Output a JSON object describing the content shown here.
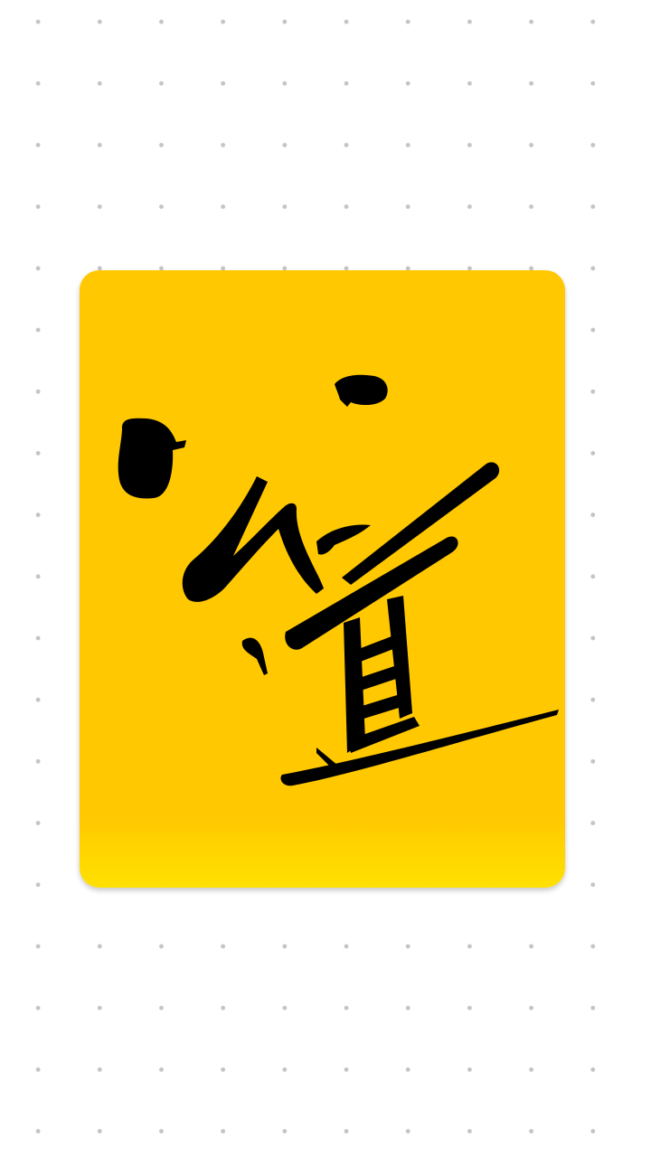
{
  "artwork": {
    "name": "calligraphy-card",
    "glyph": "道",
    "background_color": "#ffc800",
    "ink_color": "#000000"
  }
}
